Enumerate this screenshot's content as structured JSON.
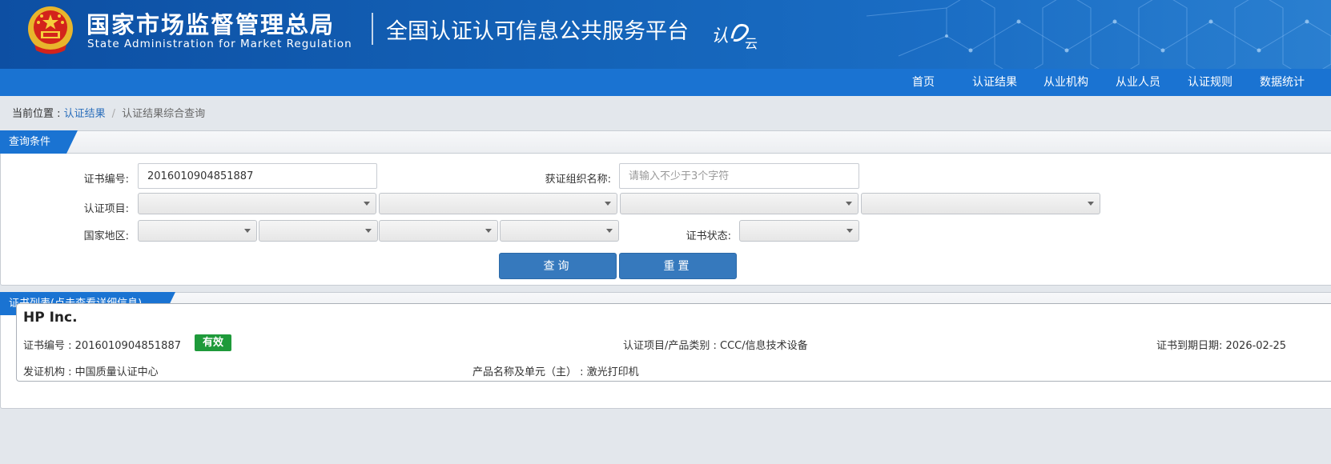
{
  "header": {
    "org_name_cn": "国家市场监督管理总局",
    "org_name_en": "State Administration  for  Market Regulation",
    "platform_title": "全国认证认可信息公共服务平台",
    "brand_logo_text": "认e云"
  },
  "nav": {
    "items": [
      {
        "label": "首页"
      },
      {
        "label": "认证结果"
      },
      {
        "label": "从业机构"
      },
      {
        "label": "从业人员"
      },
      {
        "label": "认证规则"
      },
      {
        "label": "数据统计"
      }
    ]
  },
  "breadcrumb": {
    "prefix": "当前位置 : ",
    "link": "认证结果",
    "separator": "/",
    "current": "认证结果综合查询"
  },
  "query": {
    "tab_label": "查询条件",
    "cert_no_label": "证书编号:",
    "cert_no_value": "2016010904851887",
    "org_name_label": "获证组织名称:",
    "org_name_placeholder": "请输入不少于3个字符",
    "org_name_value": "",
    "project_label": "认证项目:",
    "region_label": "国家地区:",
    "status_label": "证书状态:",
    "search_button": "查询",
    "reset_button": "重置"
  },
  "results": {
    "tab_label": "证书列表(点击查看详细信息)",
    "items": [
      {
        "org_name": "HP Inc.",
        "cert_no_label": "证书编号 : ",
        "cert_no": "2016010904851887",
        "status": "有效",
        "status_color": "#1e9a3a",
        "category_label": "认证项目/产品类别 : ",
        "category": "CCC/信息技术设备",
        "expiry_label": "证书到期日期: ",
        "expiry": "2026-02-25",
        "issuer_label": "发证机构 : ",
        "issuer": "中国质量认证中心",
        "product_label": "产品名称及单元（主） : ",
        "product": "激光打印机"
      }
    ]
  },
  "colors": {
    "header_blue": "#0d4fa3",
    "nav_blue": "#1a73d2",
    "button_blue": "#3679bd",
    "link_blue": "#2a6ebb",
    "valid_green": "#1e9a3a",
    "page_bg": "#e3e7ec"
  }
}
